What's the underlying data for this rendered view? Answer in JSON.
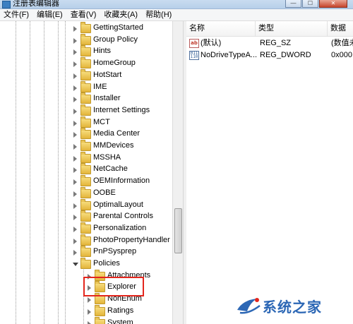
{
  "window": {
    "title": "注册表编辑器"
  },
  "window_buttons": {
    "minimize": "—",
    "maximize": "☐",
    "close": "✕"
  },
  "menu": [
    "文件(F)",
    "编辑(E)",
    "查看(V)",
    "收藏夹(A)",
    "帮助(H)"
  ],
  "tree": {
    "items": [
      {
        "label": "GettingStarted",
        "expanded": false
      },
      {
        "label": "Group Policy",
        "expanded": false
      },
      {
        "label": "Hints",
        "expanded": false
      },
      {
        "label": "HomeGroup",
        "expanded": false
      },
      {
        "label": "HotStart",
        "expanded": false
      },
      {
        "label": "IME",
        "expanded": false
      },
      {
        "label": "Installer",
        "expanded": false
      },
      {
        "label": "Internet Settings",
        "expanded": false
      },
      {
        "label": "MCT",
        "expanded": false
      },
      {
        "label": "Media Center",
        "expanded": false
      },
      {
        "label": "MMDevices",
        "expanded": false
      },
      {
        "label": "MSSHA",
        "expanded": false
      },
      {
        "label": "NetCache",
        "expanded": false
      },
      {
        "label": "OEMInformation",
        "expanded": false
      },
      {
        "label": "OOBE",
        "expanded": false
      },
      {
        "label": "OptimalLayout",
        "expanded": false
      },
      {
        "label": "Parental Controls",
        "expanded": false
      },
      {
        "label": "Personalization",
        "expanded": false
      },
      {
        "label": "PhotoPropertyHandler",
        "expanded": false
      },
      {
        "label": "PnPSysprep",
        "expanded": false
      },
      {
        "label": "Policies",
        "expanded": true
      },
      {
        "label": "Attachments",
        "expanded": false
      },
      {
        "label": "Explorer",
        "expanded": false,
        "selected": true
      },
      {
        "label": "NonEnum",
        "expanded": false
      },
      {
        "label": "Ratings",
        "expanded": false
      },
      {
        "label": "System",
        "expanded": false
      }
    ]
  },
  "list": {
    "columns": [
      "名称",
      "类型",
      "数据"
    ],
    "rows": [
      {
        "icon": "string-value-icon",
        "name": "(默认)",
        "type": "REG_SZ",
        "data": "(数值未"
      },
      {
        "icon": "binary-value-icon",
        "name": "NoDriveTypeA...",
        "type": "REG_DWORD",
        "data": "0x000"
      }
    ]
  },
  "watermark": {
    "text": "系统之家"
  },
  "colors": {
    "highlight_box": "#e3261d",
    "folder": "#e3b53b",
    "watermark": "#2c67b5"
  }
}
